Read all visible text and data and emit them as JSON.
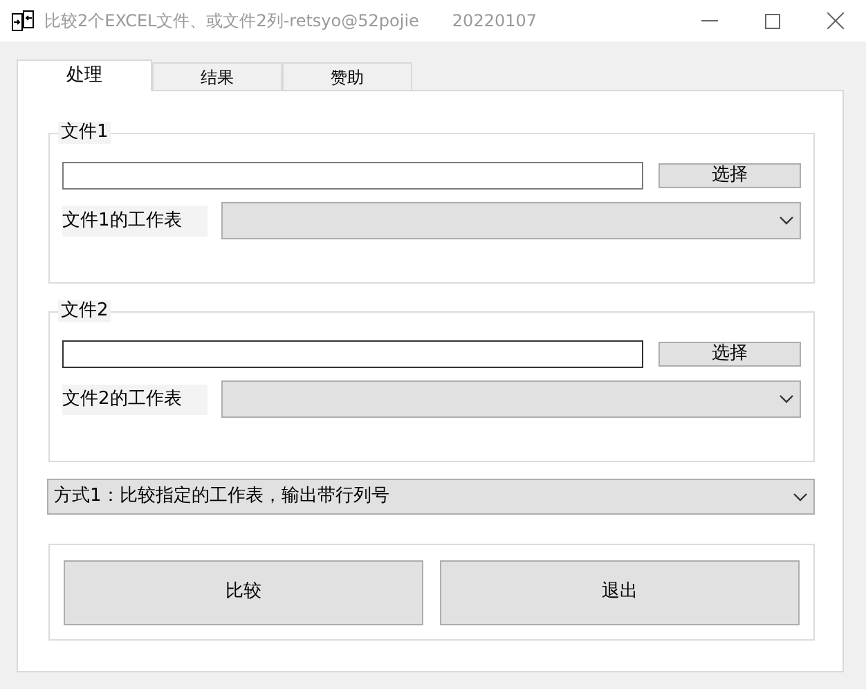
{
  "window": {
    "title": "比较2个EXCEL文件、或文件2列-retsyo@52pojie",
    "version": "20220107"
  },
  "tabs": [
    {
      "label": "处理",
      "selected": true
    },
    {
      "label": "结果",
      "selected": false
    },
    {
      "label": "赞助",
      "selected": false
    }
  ],
  "files": [
    {
      "group": "文件1",
      "path_focused": false,
      "choose": "选择",
      "sheet_label": "文件1的工作表"
    },
    {
      "group": "文件2",
      "path_focused": true,
      "choose": "选择",
      "sheet_label": "文件2的工作表"
    }
  ],
  "mode": {
    "value": "方式1：比较指定的工作表，输出带行列号"
  },
  "buttons": [
    "比较",
    "退出"
  ]
}
